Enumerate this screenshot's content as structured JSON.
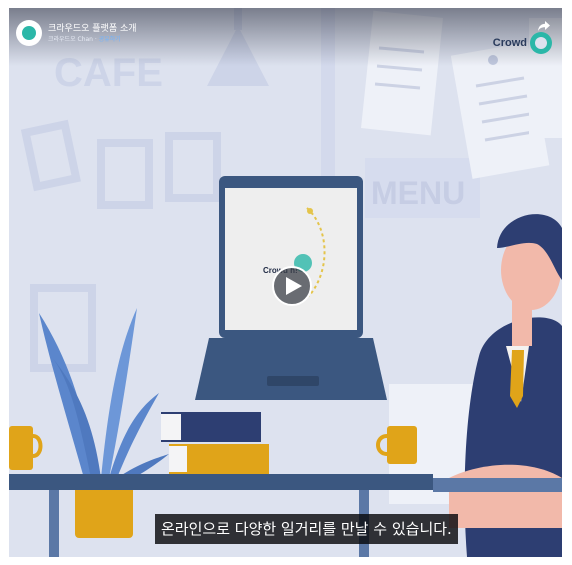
{
  "header": {
    "title": "크라우드오 플랫폼 소개",
    "subtitle_prefix": "크라우드오 Chan ·",
    "subtitle_highlight": "공유하기"
  },
  "brand": {
    "corner_text": "Crowd",
    "screen_text": "Crowd      h!"
  },
  "scene_text": {
    "cafe_sign": "CAFE",
    "menu_sign": "MENU"
  },
  "caption": {
    "text": "온라인으로 다양한 일거리를 만날 수 있습니다."
  },
  "icons": {
    "share": "share-icon",
    "play": "play-icon",
    "avatar": "channel-avatar-icon"
  },
  "colors": {
    "background": "#dde2ef",
    "accent_teal": "#2bb7a8",
    "navy": "#2d3e72",
    "laptop": "#3b5780",
    "mustard": "#e0a419",
    "plant": "#5b86cc"
  }
}
